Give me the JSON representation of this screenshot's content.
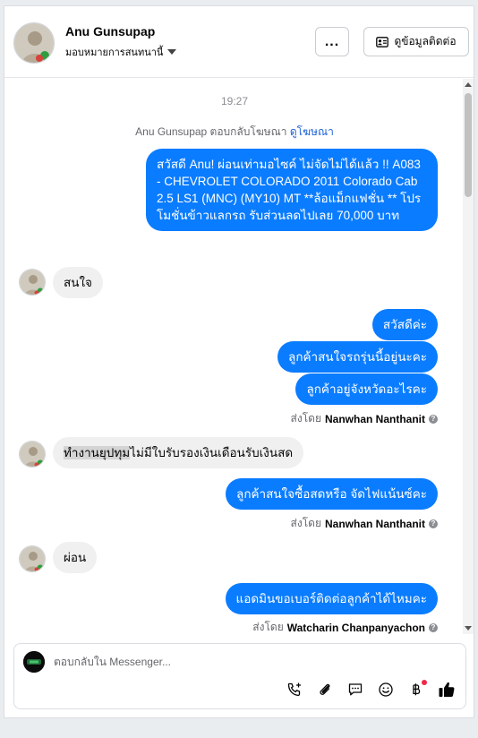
{
  "header": {
    "name": "Anu Gunsupap",
    "assign_label": "มอบหมายการสนทนานี้",
    "more_label": "...",
    "contact_label": "ดูข้อมูลติดต่อ"
  },
  "thread": {
    "time": "19:27",
    "ad_reply_text": "Anu Gunsupap ตอบกลับโฆษณา",
    "ad_link": "ดูโฆษณา",
    "messages": [
      {
        "text": "สวัสดี Anu! ผ่อนเท่ามอไซค์ ไม่จัดไม่ได้แล้ว !! A083 - CHEVROLET COLORADO 2011 Colorado Cab 2.5 LS1 (MNC) (MY10) MT **ล้อแม็กแฟชั่น ** โปรโมชั่นข้าวแลกรถ รับส่วนลดไปเลย 70,000 บาท"
      },
      {
        "text": "สนใจ"
      },
      {
        "text": "สวัสดีค่ะ"
      },
      {
        "text": "ลูกค้าสนใจรถรุ่นนี้อยู่นะคะ"
      },
      {
        "text": "ลูกค้าอยู่จังหวัดอะไรคะ"
      },
      {
        "sent_by_label": "ส่งโดย",
        "sender": "Nanwhan Nanthanit"
      },
      {
        "highlight": "ทำงานยุปทุม",
        "text": "ไม่มีใบรับรองเงินเดือนรับเงินสด"
      },
      {
        "text": "ลูกค้าสนใจซื้อสดหรือ จัดไฟแน้นซ์คะ"
      },
      {
        "sent_by_label": "ส่งโดย",
        "sender": "Nanwhan Nanthanit"
      },
      {
        "text": "ผ่อน"
      },
      {
        "text": "แอดมินขอเบอร์ติดต่อลูกค้าได้ไหมคะ"
      },
      {
        "sent_by_label": "ส่งโดย",
        "sender": "Watcharin Chanpanyachon"
      }
    ]
  },
  "composer": {
    "placeholder": "ตอบกลับใน Messenger..."
  },
  "icons": [
    "more-icon",
    "contact-card-icon",
    "call-icon",
    "attachment-icon",
    "message-icon",
    "emoji-icon",
    "baht-icon",
    "like-icon"
  ],
  "colors": {
    "outgoing_bubble": "#0a7cff",
    "incoming_bubble": "#f0f0f0",
    "link": "#1b5fd6"
  }
}
